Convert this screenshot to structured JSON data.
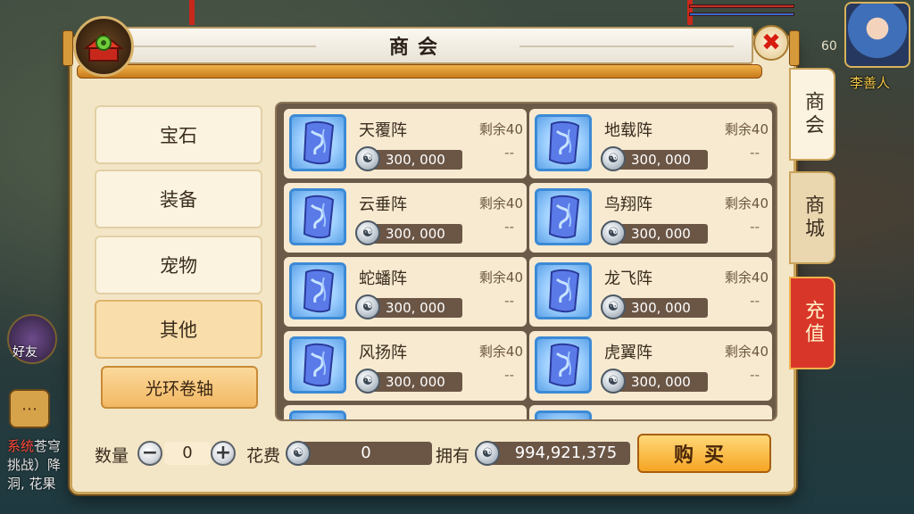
{
  "window": {
    "title": "商会"
  },
  "side_tabs": [
    {
      "label": "商会",
      "active": true
    },
    {
      "label": "商城",
      "active": false
    },
    {
      "label": "充值",
      "active": false
    }
  ],
  "categories": [
    {
      "label": "宝石",
      "active": false
    },
    {
      "label": "装备",
      "active": false
    },
    {
      "label": "宠物",
      "active": false
    },
    {
      "label": "其他",
      "active": true
    }
  ],
  "subcategory": {
    "label": "光环卷轴"
  },
  "items": [
    {
      "name": "天覆阵",
      "stock": "剩余40",
      "price": "300, 000",
      "limit": "--"
    },
    {
      "name": "地载阵",
      "stock": "剩余40",
      "price": "300, 000",
      "limit": "--"
    },
    {
      "name": "云垂阵",
      "stock": "剩余40",
      "price": "300, 000",
      "limit": "--"
    },
    {
      "name": "鸟翔阵",
      "stock": "剩余40",
      "price": "300, 000",
      "limit": "--"
    },
    {
      "name": "蛇蟠阵",
      "stock": "剩余40",
      "price": "300, 000",
      "limit": "--"
    },
    {
      "name": "龙飞阵",
      "stock": "剩余40",
      "price": "300, 000",
      "limit": "--"
    },
    {
      "name": "风扬阵",
      "stock": "剩余40",
      "price": "300, 000",
      "limit": "--"
    },
    {
      "name": "虎翼阵",
      "stock": "剩余40",
      "price": "300, 000",
      "limit": "--"
    }
  ],
  "bottom": {
    "quantity_label": "数量",
    "quantity_value": "0",
    "minus": "−",
    "plus": "+",
    "cost_label": "花费",
    "cost_value": "0",
    "owned_label": "拥有",
    "owned_value": "994,921,375",
    "buy_label": "购买"
  },
  "hud": {
    "player_name": "李善人",
    "player_level": "60",
    "friends_label": "好友",
    "chat_lines": [
      {
        "tag": "系统",
        "text": "苍穹"
      },
      {
        "tag": "",
        "text": "挑战）降"
      },
      {
        "tag": "",
        "text": "洞, 花果"
      }
    ]
  },
  "colors": {
    "panel_bg": "#f3e6c7",
    "accent_gold": "#f6a524",
    "recharge_red": "#d9362a",
    "icon_border_blue": "#3c8ad6"
  },
  "icons": {
    "shop": "merchant-guild-icon",
    "close": "close-icon",
    "scroll": "aura-scroll-icon",
    "coin": "silver-coin-icon"
  }
}
